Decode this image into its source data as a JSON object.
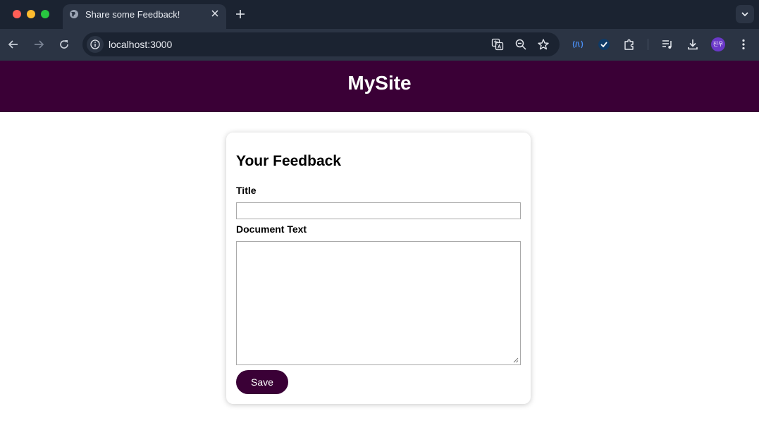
{
  "browser": {
    "tab_title": "Share some Feedback!",
    "url_host": "localhost",
    "url_port": ":3000",
    "profile_initials": "진우"
  },
  "site": {
    "title": "MySite"
  },
  "form": {
    "heading": "Your Feedback",
    "title_label": "Title",
    "title_value": "",
    "document_label": "Document Text",
    "document_value": "",
    "save_label": "Save"
  },
  "colors": {
    "brand": "#3a0036",
    "chrome_dark": "#1b2331",
    "chrome_mid": "#2b3444"
  }
}
